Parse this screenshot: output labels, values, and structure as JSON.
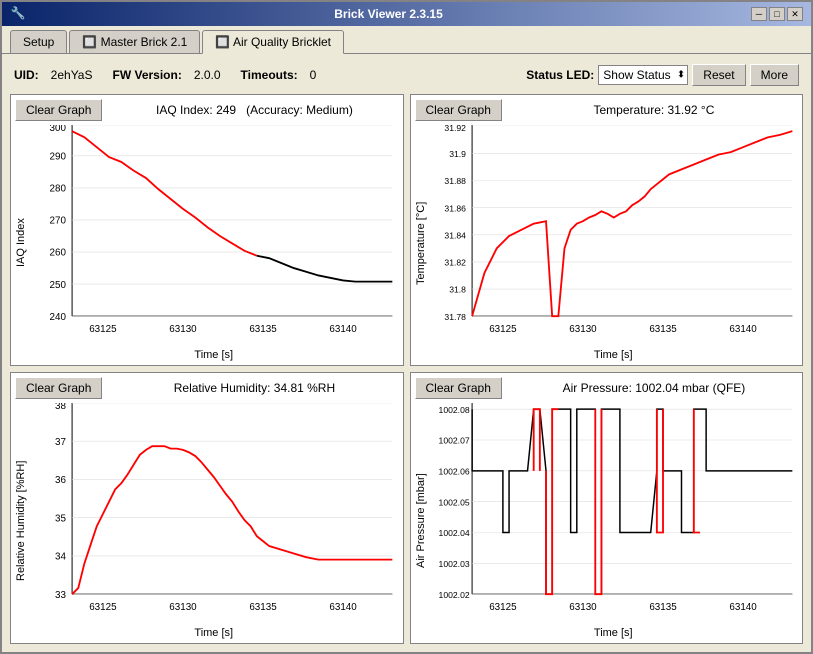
{
  "window": {
    "title": "Brick Viewer 2.3.15",
    "icon": "🔧"
  },
  "tabs": [
    {
      "label": "Setup",
      "active": false
    },
    {
      "label": "Master Brick 2.1",
      "active": false
    },
    {
      "label": "Air Quality Bricklet",
      "active": true
    }
  ],
  "info": {
    "uid_label": "UID:",
    "uid_value": "2ehYaS",
    "fw_label": "FW Version:",
    "fw_value": "2.0.0",
    "timeouts_label": "Timeouts:",
    "timeouts_value": "0",
    "status_led_label": "Status LED:",
    "status_led_value": "Show Status",
    "reset_label": "Reset",
    "more_label": "More"
  },
  "graphs": {
    "iaq": {
      "clear_label": "Clear Graph",
      "title": "IAQ Index: 249",
      "subtitle": "(Accuracy: Medium)",
      "y_label": "IAQ Index",
      "x_label": "Time [s]",
      "y_min": 240,
      "y_max": 300,
      "x_ticks": [
        "63125",
        "63130",
        "63135",
        "63140"
      ],
      "y_ticks": [
        "240",
        "250",
        "260",
        "270",
        "280",
        "290",
        "300"
      ]
    },
    "temp": {
      "clear_label": "Clear Graph",
      "title": "Temperature: 31.92 °C",
      "y_label": "Temperature [°C]",
      "x_label": "Time [s]",
      "y_min": 31.78,
      "y_max": 31.92,
      "x_ticks": [
        "63125",
        "63130",
        "63135",
        "63140"
      ],
      "y_ticks": [
        "31.78",
        "31.8",
        "31.82",
        "31.84",
        "31.86",
        "31.88",
        "31.9",
        "31.92"
      ]
    },
    "humidity": {
      "clear_label": "Clear Graph",
      "title": "Relative Humidity: 34.81 %RH",
      "y_label": "Relative Humidity [%RH]",
      "x_label": "Time [s]",
      "y_min": 33,
      "y_max": 38,
      "x_ticks": [
        "63125",
        "63130",
        "63135",
        "63140"
      ],
      "y_ticks": [
        "33",
        "34",
        "35",
        "36",
        "37",
        "38"
      ]
    },
    "pressure": {
      "clear_label": "Clear Graph",
      "title": "Air Pressure: 1002.04 mbar (QFE)",
      "y_label": "Air Pressure [mbar]",
      "x_label": "Time [s]",
      "y_min": 1002.02,
      "y_max": 1002.08,
      "x_ticks": [
        "63125",
        "63130",
        "63135",
        "63140"
      ],
      "y_ticks": [
        "1002.02",
        "1002.03",
        "1002.04",
        "1002.05",
        "1002.06",
        "1002.07",
        "1002.08"
      ]
    }
  },
  "title_controls": {
    "minimize": "─",
    "maximize": "□",
    "close": "✕"
  }
}
